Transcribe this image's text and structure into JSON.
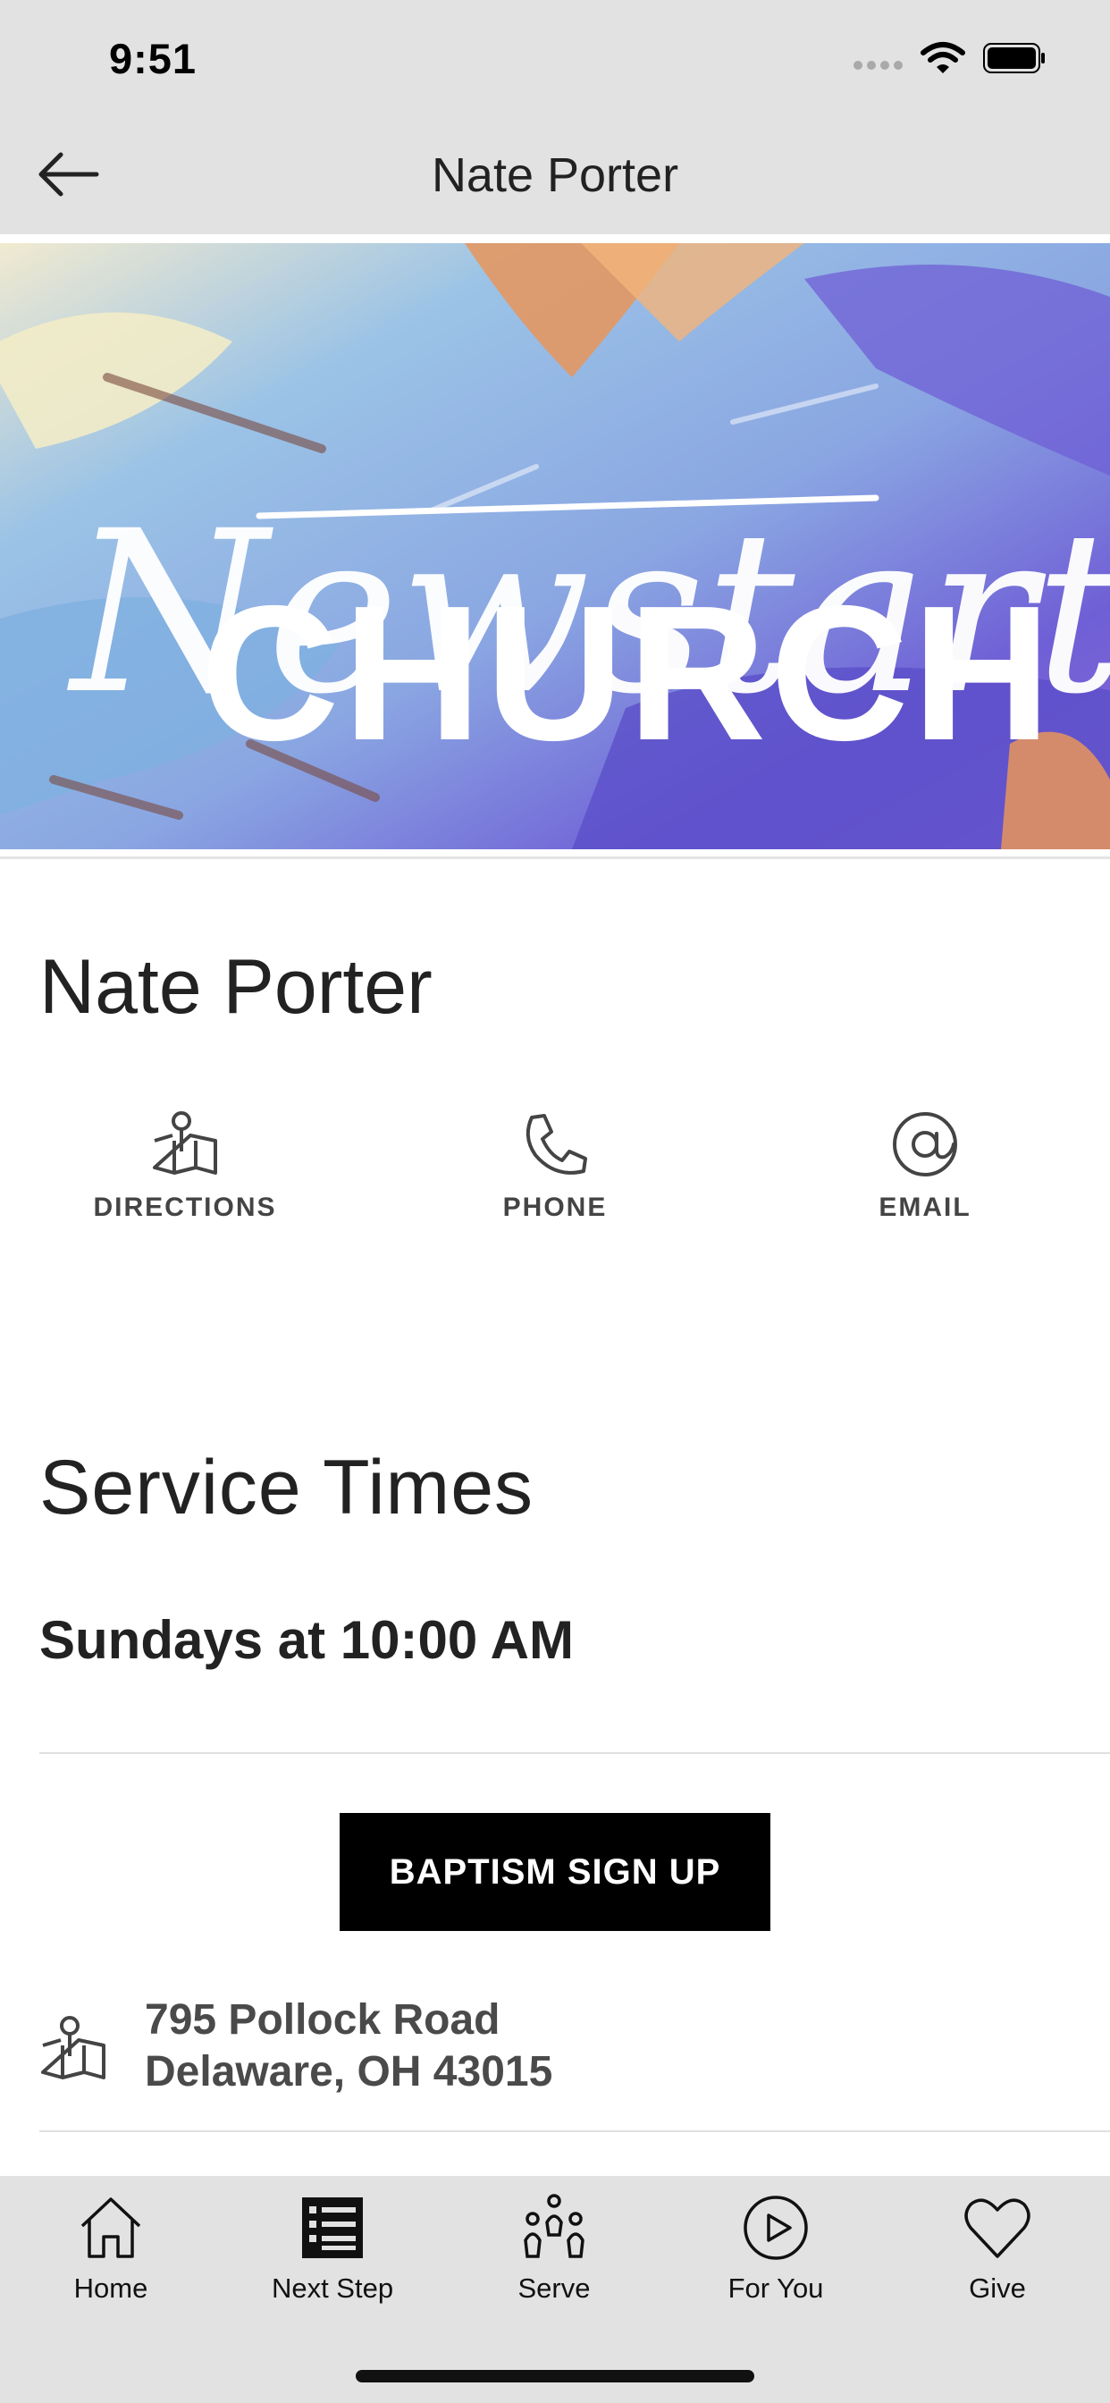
{
  "status_bar": {
    "time": "9:51"
  },
  "nav": {
    "title": "Nate Porter",
    "back_icon": "arrow-left-icon"
  },
  "hero": {
    "logo_script_text": "Newstart",
    "logo_block_text": "CHURCH",
    "colors": {
      "purple": "#6f5fd6",
      "blue": "#7fb0e0",
      "orange": "#e8955a",
      "cream": "#f1ead0"
    }
  },
  "contact": {
    "name": "Nate Porter",
    "actions": [
      {
        "label": "DIRECTIONS",
        "icon": "map-pin-icon"
      },
      {
        "label": "PHONE",
        "icon": "phone-icon"
      },
      {
        "label": "EMAIL",
        "icon": "at-sign-icon"
      }
    ]
  },
  "service_times": {
    "title": "Service Times",
    "time": "Sundays at 10:00 AM"
  },
  "cta": {
    "label": "BAPTISM SIGN UP"
  },
  "address": {
    "line1": "795 Pollock Road",
    "line2": "Delaware, OH 43015",
    "icon": "map-pin-icon"
  },
  "tabbar": {
    "tabs": [
      {
        "label": "Home",
        "icon": "home-icon"
      },
      {
        "label": "Next Step",
        "icon": "list-icon"
      },
      {
        "label": "Serve",
        "icon": "people-icon"
      },
      {
        "label": "For You",
        "icon": "play-circle-icon"
      },
      {
        "label": "Give",
        "icon": "heart-icon"
      }
    ]
  }
}
